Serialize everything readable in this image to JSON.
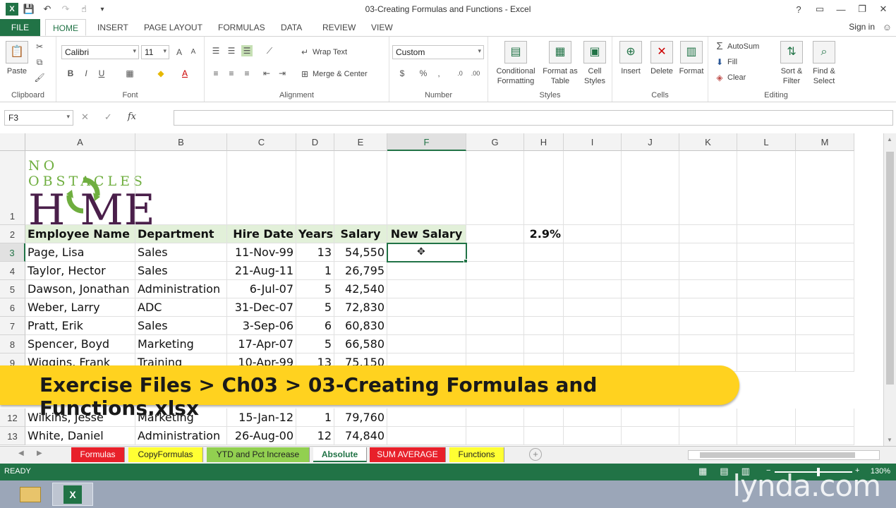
{
  "titlebar": {
    "title": "03-Creating Formulas and Functions - Excel"
  },
  "window_controls": {
    "help": "?",
    "restore_ribbon": "▭",
    "minimize": "—",
    "maximize": "❐",
    "close": "✕"
  },
  "ribbon_tabs": [
    "FILE",
    "HOME",
    "INSERT",
    "PAGE LAYOUT",
    "FORMULAS",
    "DATA",
    "REVIEW",
    "VIEW"
  ],
  "signin": "Sign in",
  "ribbon": {
    "clipboard": {
      "label": "Clipboard",
      "paste": "Paste"
    },
    "font": {
      "label": "Font",
      "name": "Calibri",
      "size": "11"
    },
    "alignment": {
      "label": "Alignment",
      "wrap_text": "Wrap Text",
      "merge_center": "Merge & Center"
    },
    "number": {
      "label": "Number",
      "format": "Custom",
      "currency": "$",
      "percent": "%",
      "comma": ","
    },
    "styles": {
      "label": "Styles",
      "conditional": "Conditional Formatting",
      "format_table": "Format as Table",
      "cell_styles": "Cell Styles"
    },
    "cells": {
      "label": "Cells",
      "insert": "Insert",
      "delete": "Delete",
      "format": "Format"
    },
    "editing": {
      "label": "Editing",
      "autosum": "AutoSum",
      "fill": "Fill",
      "clear": "Clear",
      "sort_filter": "Sort & Filter",
      "find_select": "Find & Select"
    }
  },
  "formula_bar": {
    "name_box": "F3",
    "fx": "fx",
    "cancel": "✕",
    "enter": "✓",
    "formula": ""
  },
  "columns": [
    "A",
    "B",
    "C",
    "D",
    "E",
    "F",
    "G",
    "H",
    "I",
    "J",
    "K",
    "L",
    "M"
  ],
  "logo": {
    "line1": "NO OBSTACLES",
    "line2": "H  ME"
  },
  "header_row": {
    "row": "2",
    "name": "Employee Name",
    "dept": "Department",
    "hire": "Hire Date",
    "years": "Years",
    "salary": "Salary",
    "new_salary": "New Salary",
    "pct": "2.9%"
  },
  "rows": [
    {
      "row": "3",
      "name": "Page, Lisa",
      "dept": "Sales",
      "hire": "11-Nov-99",
      "years": "13",
      "salary": "54,550"
    },
    {
      "row": "4",
      "name": "Taylor, Hector",
      "dept": "Sales",
      "hire": "21-Aug-11",
      "years": "1",
      "salary": "26,795"
    },
    {
      "row": "5",
      "name": "Dawson, Jonathan",
      "dept": "Administration",
      "hire": "6-Jul-07",
      "years": "5",
      "salary": "42,540"
    },
    {
      "row": "6",
      "name": "Weber, Larry",
      "dept": "ADC",
      "hire": "31-Dec-07",
      "years": "5",
      "salary": "72,830"
    },
    {
      "row": "7",
      "name": "Pratt, Erik",
      "dept": "Sales",
      "hire": "3-Sep-06",
      "years": "6",
      "salary": "60,830"
    },
    {
      "row": "8",
      "name": "Spencer, Boyd",
      "dept": "Marketing",
      "hire": "17-Apr-07",
      "years": "5",
      "salary": "66,580"
    },
    {
      "row": "9",
      "name": "Wiggins, Frank",
      "dept": "Training",
      "hire": "10-Apr-99",
      "years": "13",
      "salary": "75,150"
    },
    {
      "row": "12",
      "name": "Wilkins, Jesse",
      "dept": "Marketing",
      "hire": "15-Jan-12",
      "years": "1",
      "salary": "79,760"
    },
    {
      "row": "13",
      "name": "White, Daniel",
      "dept": "Administration",
      "hire": "26-Aug-00",
      "years": "12",
      "salary": "74,840"
    }
  ],
  "row1_label": "1",
  "banner": "Exercise Files > Ch03 > 03-Creating Formulas and Functions.xlsx",
  "sheet_tabs": [
    {
      "name": "Formulas",
      "color": "#e8202a"
    },
    {
      "name": "CopyFormulas",
      "color": "#ffff33"
    },
    {
      "name": "YTD and Pct Increase",
      "color": "#92d050"
    },
    {
      "name": "Absolute",
      "color": "#ffffff"
    },
    {
      "name": "SUM AVERAGE",
      "color": "#e8202a"
    },
    {
      "name": "Functions",
      "color": "#ffff33"
    }
  ],
  "status": {
    "ready": "READY",
    "zoom": "130%",
    "zoom_minus": "−",
    "zoom_plus": "+"
  },
  "watermark": "lynda.com",
  "colors": {
    "excel_green": "#217346",
    "header_fill": "#e2f0d9",
    "banner": "#ffd21f"
  }
}
